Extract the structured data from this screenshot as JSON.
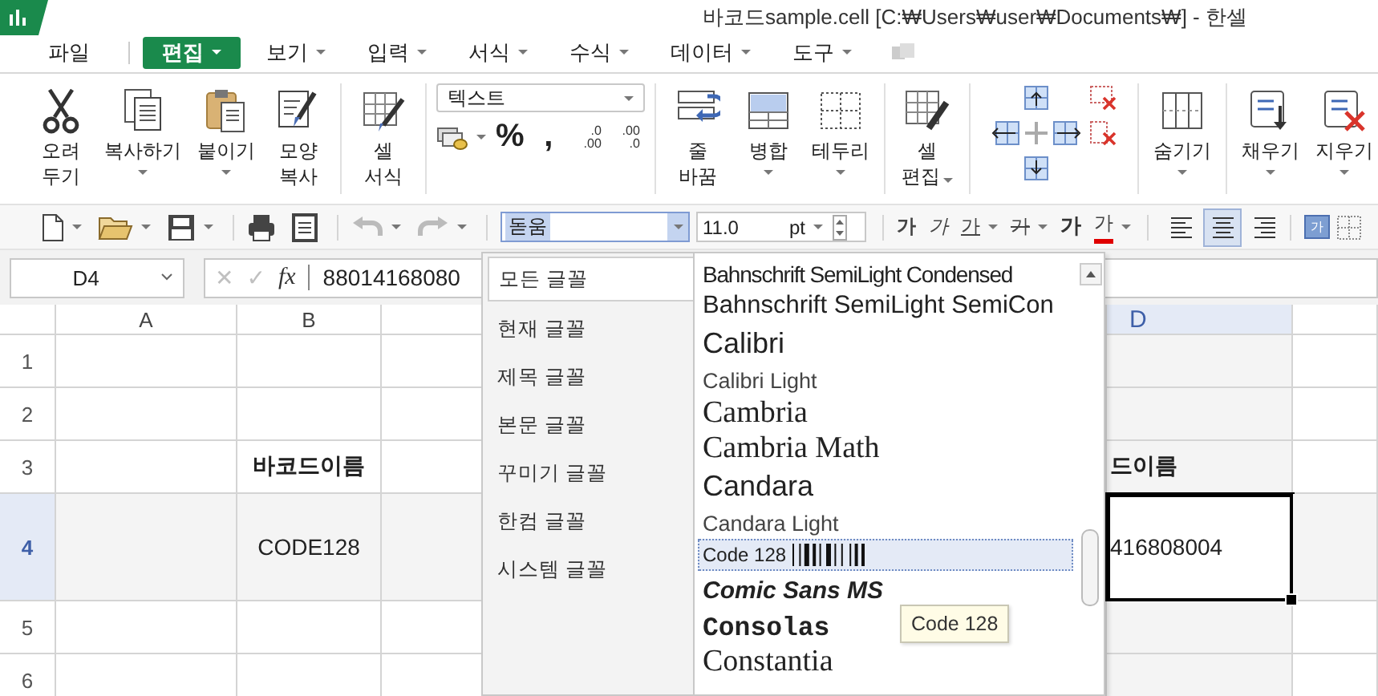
{
  "window": {
    "title": "바코드sample.cell [C:₩Users₩user₩Documents₩] - 한셀"
  },
  "menu": [
    {
      "label": "파일",
      "selected": false,
      "dropdown": false
    },
    {
      "label": "편집",
      "selected": true,
      "dropdown": true
    },
    {
      "label": "보기",
      "selected": false,
      "dropdown": true
    },
    {
      "label": "입력",
      "selected": false,
      "dropdown": true
    },
    {
      "label": "서식",
      "selected": false,
      "dropdown": true
    },
    {
      "label": "수식",
      "selected": false,
      "dropdown": true
    },
    {
      "label": "데이터",
      "selected": false,
      "dropdown": true
    },
    {
      "label": "도구",
      "selected": false,
      "dropdown": true
    }
  ],
  "ribbon": {
    "groups": [
      {
        "kind": "buttons",
        "buttons": [
          {
            "label": "오려\n두기",
            "dropdown": false
          },
          {
            "label": "복사하기",
            "dropdown": true
          },
          {
            "label": "붙이기",
            "dropdown": true
          },
          {
            "label": "모양\n복사",
            "dropdown": false
          }
        ]
      },
      {
        "kind": "buttons",
        "buttons": [
          {
            "label": "셀\n서식",
            "dropdown": false
          }
        ]
      },
      {
        "kind": "number_format",
        "format": "텍스트",
        "buttons": [
          {
            "kind": "icon",
            "dropdown": true
          },
          {
            "kind": "glyph",
            "label": "%"
          },
          {
            "kind": "glyph",
            "label": ","
          },
          {
            "kind": "decimal",
            "label": ".0\n.00"
          },
          {
            "kind": "decimal",
            "label": ".00\n.0"
          }
        ]
      },
      {
        "kind": "buttons",
        "buttons": [
          {
            "label": "줄\n바꿈",
            "dropdown": false
          },
          {
            "label": "병합",
            "dropdown": true
          },
          {
            "label": "테두리",
            "dropdown": true
          }
        ]
      },
      {
        "kind": "buttons",
        "buttons": [
          {
            "label": "셀\n편집",
            "dropdown": true
          }
        ]
      },
      {
        "kind": "cell_ops"
      },
      {
        "kind": "buttons",
        "buttons": [
          {
            "label": "숨기기",
            "dropdown": true
          }
        ]
      },
      {
        "kind": "buttons",
        "buttons": [
          {
            "label": "채우기",
            "dropdown": true
          },
          {
            "label": "지우기",
            "dropdown": true
          }
        ]
      }
    ]
  },
  "toolbar": {
    "undo": {
      "disabled": true
    },
    "redo": {
      "disabled": true
    },
    "font": {
      "value": "돋움",
      "open": true
    },
    "size": {
      "value": "11.0",
      "unit": "pt"
    },
    "styles": [
      {
        "label": "가",
        "kind": "bold",
        "dropdown": false
      },
      {
        "label": "가",
        "kind": "italic",
        "dropdown": false
      },
      {
        "label": "가",
        "kind": "underline",
        "dropdown": true
      },
      {
        "label": "가",
        "kind": "strike",
        "dropdown": true
      },
      {
        "label": "가",
        "kind": "emboss",
        "dropdown": false
      },
      {
        "label": "가",
        "kind": "color",
        "dropdown": true,
        "color": "#e00000"
      }
    ],
    "align": [
      {
        "kind": "left",
        "selected": false
      },
      {
        "kind": "center",
        "selected": true
      },
      {
        "kind": "right",
        "selected": false
      }
    ],
    "cell_style": "가"
  },
  "formula_bar": {
    "cell": "D4",
    "cancel": "✕",
    "confirm": "✓",
    "function": "fx",
    "value": "88014168080"
  },
  "sheet": {
    "columns": [
      {
        "label": "A",
        "selected": false
      },
      {
        "label": "B",
        "selected": false
      },
      {
        "label": "D",
        "selected": true
      }
    ],
    "rows": [
      {
        "label": "1",
        "selected": false,
        "cells": []
      },
      {
        "label": "2",
        "selected": false,
        "cells": []
      },
      {
        "label": "3",
        "selected": false,
        "bold": true,
        "cells": [
          "",
          "바코드이름",
          "드이름"
        ]
      },
      {
        "label": "4",
        "selected": true,
        "bold": false,
        "cells": [
          "",
          "CODE128",
          "416808004"
        ]
      },
      {
        "label": "5",
        "selected": false,
        "cells": []
      },
      {
        "label": "6",
        "selected": false,
        "cells": []
      }
    ]
  },
  "font_menu": {
    "categories": [
      {
        "label": "모든 글꼴",
        "selected": true
      },
      {
        "label": "현재 글꼴",
        "selected": false
      },
      {
        "label": "제목 글꼴",
        "selected": false
      },
      {
        "label": "본문 글꼴",
        "selected": false
      },
      {
        "label": "꾸미기 글꼴",
        "selected": false
      },
      {
        "label": "한컴 글꼴",
        "selected": false
      },
      {
        "label": "시스템 글꼴",
        "selected": false
      }
    ],
    "fonts": [
      {
        "name": "Bahnschrift SemiLight Condensed",
        "kind": "condensed",
        "selected": false
      },
      {
        "name": "Bahnschrift SemiLight SemiCon",
        "kind": "sans",
        "selected": false
      },
      {
        "name": "Calibri",
        "kind": "sans-large",
        "selected": false
      },
      {
        "name": "Calibri Light",
        "kind": "light",
        "selected": false
      },
      {
        "name": "Cambria",
        "kind": "serif",
        "selected": false
      },
      {
        "name": "Cambria Math",
        "kind": "serif",
        "selected": false
      },
      {
        "name": "Candara",
        "kind": "sans-large",
        "selected": false
      },
      {
        "name": "Candara Light",
        "kind": "light",
        "selected": false
      },
      {
        "name": "Code 128",
        "kind": "barcode",
        "selected": true
      },
      {
        "name": "Comic Sans MS",
        "kind": "casual",
        "selected": false
      },
      {
        "name": "Consolas",
        "kind": "mono",
        "selected": false
      },
      {
        "name": "Constantia",
        "kind": "serif",
        "selected": false
      }
    ],
    "tooltip": "Code 128"
  }
}
